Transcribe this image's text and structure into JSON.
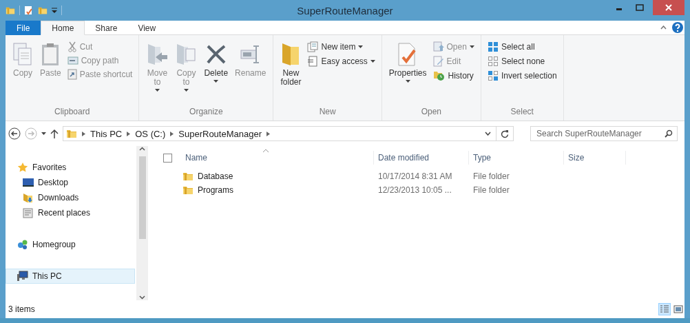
{
  "window": {
    "title": "SuperRouteManager"
  },
  "ribbon_tabs": [
    {
      "label": "File",
      "kind": "file",
      "selected": false
    },
    {
      "label": "Home",
      "kind": "tab",
      "selected": true
    },
    {
      "label": "Share",
      "kind": "tab",
      "selected": false
    },
    {
      "label": "View",
      "kind": "tab",
      "selected": false
    }
  ],
  "ribbon_groups": [
    {
      "label": "Clipboard",
      "items": [
        {
          "label": "Copy",
          "kind": "large",
          "disabled": true,
          "dropdown": false
        },
        {
          "label": "Paste",
          "kind": "large",
          "disabled": true,
          "dropdown": false
        },
        {
          "label": "Cut",
          "kind": "small",
          "disabled": true,
          "dropdown": false
        },
        {
          "label": "Copy path",
          "kind": "small",
          "disabled": true,
          "dropdown": false
        },
        {
          "label": "Paste shortcut",
          "kind": "small",
          "disabled": true,
          "dropdown": false
        }
      ]
    },
    {
      "label": "Organize",
      "items": [
        {
          "label": "Move to",
          "kind": "large",
          "disabled": true,
          "dropdown": true
        },
        {
          "label": "Copy to",
          "kind": "large",
          "disabled": true,
          "dropdown": true
        },
        {
          "label": "Delete",
          "kind": "large",
          "disabled": false,
          "dropdown": true
        },
        {
          "label": "Rename",
          "kind": "large",
          "disabled": true,
          "dropdown": false
        }
      ]
    },
    {
      "label": "New",
      "items": [
        {
          "label": "New folder",
          "kind": "large",
          "disabled": false,
          "dropdown": false
        },
        {
          "label": "New item",
          "kind": "small",
          "disabled": false,
          "dropdown": true
        },
        {
          "label": "Easy access",
          "kind": "small",
          "disabled": false,
          "dropdown": true
        }
      ]
    },
    {
      "label": "Open",
      "items": [
        {
          "label": "Properties",
          "kind": "large",
          "disabled": false,
          "dropdown": true
        },
        {
          "label": "Open",
          "kind": "small",
          "disabled": true,
          "dropdown": true
        },
        {
          "label": "Edit",
          "kind": "small",
          "disabled": true,
          "dropdown": false
        },
        {
          "label": "History",
          "kind": "small",
          "disabled": false,
          "dropdown": false
        }
      ]
    },
    {
      "label": "Select",
      "items": [
        {
          "label": "Select all",
          "kind": "small",
          "disabled": false,
          "dropdown": false
        },
        {
          "label": "Select none",
          "kind": "small",
          "disabled": false,
          "dropdown": false
        },
        {
          "label": "Invert selection",
          "kind": "small",
          "disabled": false,
          "dropdown": false
        }
      ]
    }
  ],
  "address_bar": {
    "breadcrumbs": [
      "This PC",
      "OS (C:)",
      "SuperRouteManager"
    ]
  },
  "search": {
    "placeholder": "Search SuperRouteManager"
  },
  "navigation_pane": [
    {
      "label": "Favorites",
      "selected": false,
      "children": [
        {
          "label": "Desktop",
          "selected": false
        },
        {
          "label": "Downloads",
          "selected": false
        },
        {
          "label": "Recent places",
          "selected": false
        }
      ]
    },
    {
      "label": "Homegroup",
      "selected": false
    },
    {
      "label": "This PC",
      "selected": true
    }
  ],
  "file_list": {
    "select_all": {
      "checked": false
    },
    "columns": [
      "Name",
      "Date modified",
      "Type",
      "Size"
    ],
    "rows": [
      {
        "name": "Database",
        "date_modified": "10/17/2014 8:31 AM",
        "type": "File folder"
      },
      {
        "name": "Programs",
        "date_modified": "12/23/2013 10:05 ...",
        "type": "File folder"
      }
    ]
  },
  "status_bar": {
    "item_count": "3 items",
    "views": [
      {
        "kind": "details",
        "selected": true
      },
      {
        "kind": "large-icons",
        "selected": false
      }
    ]
  }
}
